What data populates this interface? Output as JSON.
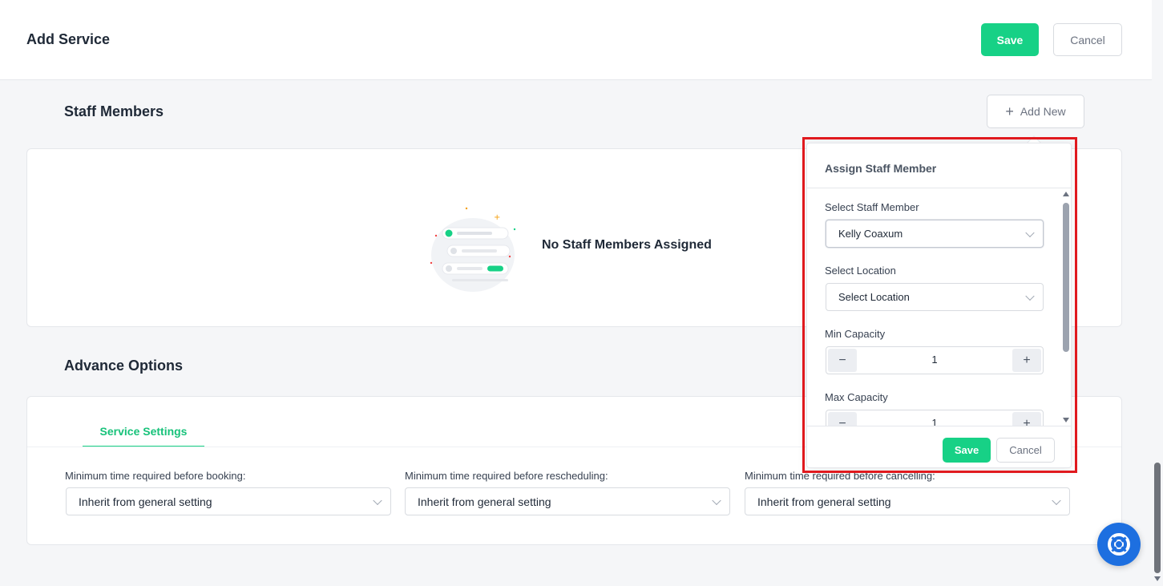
{
  "header": {
    "title": "Add Service",
    "save_label": "Save",
    "cancel_label": "Cancel"
  },
  "staff": {
    "title": "Staff Members",
    "add_new_label": "Add New",
    "empty_text": "No Staff Members Assigned"
  },
  "advance": {
    "title": "Advance Options",
    "tab_label": "Service Settings",
    "fields": [
      {
        "label": "Minimum time required before booking:",
        "value": "Inherit from general setting"
      },
      {
        "label": "Minimum time required before rescheduling:",
        "value": "Inherit from general setting"
      },
      {
        "label": "Minimum time required before cancelling:",
        "value": "Inherit from general setting"
      }
    ]
  },
  "assign_popover": {
    "title": "Assign Staff Member",
    "staff_label": "Select Staff Member",
    "staff_value": "Kelly Coaxum",
    "location_label": "Select Location",
    "location_value": "Select Location",
    "min_capacity_label": "Min Capacity",
    "min_capacity_value": "1",
    "max_capacity_label": "Max Capacity",
    "max_capacity_value": "1",
    "save_label": "Save",
    "cancel_label": "Cancel"
  },
  "colors": {
    "accent_green": "#17d186",
    "highlight_red": "#e0191e",
    "help_blue": "#1d6fe0"
  },
  "icons": [
    "plus-icon",
    "chevron-down-icon",
    "minus-icon",
    "lifebuoy-icon"
  ]
}
